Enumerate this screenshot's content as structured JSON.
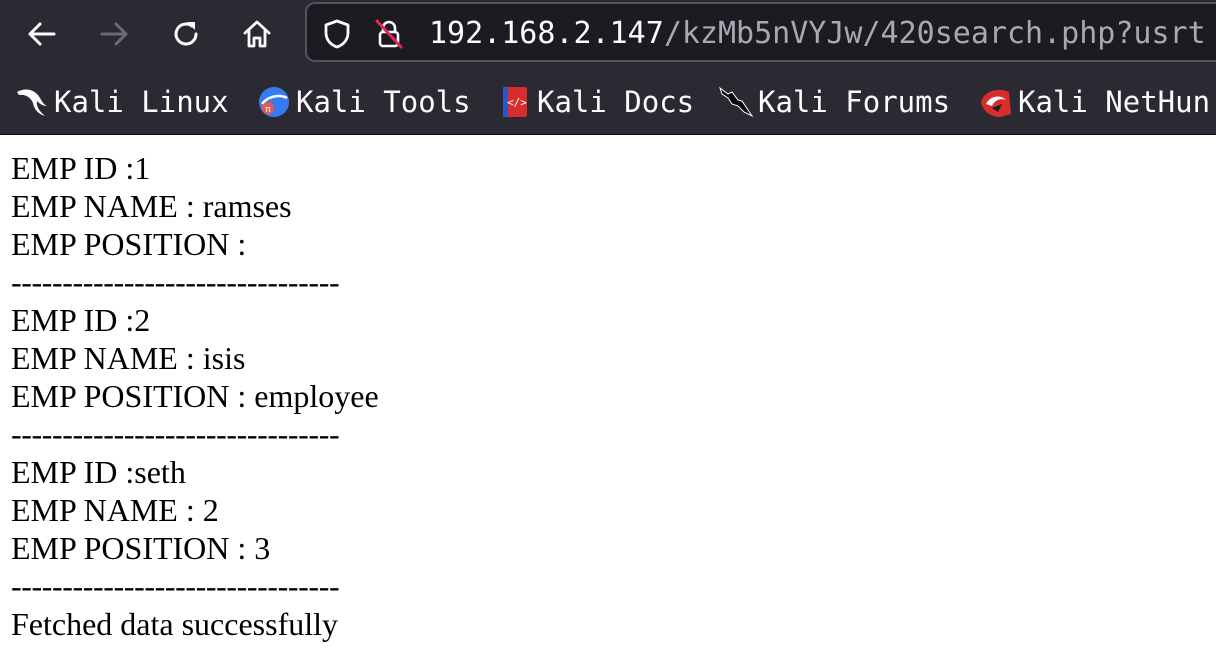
{
  "toolbar": {
    "back_icon": "arrow-left-icon",
    "forward_icon": "arrow-right-icon",
    "reload_icon": "reload-icon",
    "home_icon": "home-icon",
    "url_host": "192.168.2.147",
    "url_path": "/kzMb5nVYJw/420search.php?usrt",
    "shield_icon": "shield-icon",
    "insecure_lock_icon": "insecure-lock-icon"
  },
  "bookmarks": [
    {
      "label": "Kali Linux",
      "icon": "kali-dragon-icon"
    },
    {
      "label": "Kali Tools",
      "icon": "kali-tools-icon"
    },
    {
      "label": "Kali Docs",
      "icon": "kali-docs-icon"
    },
    {
      "label": "Kali Forums",
      "icon": "kali-forums-icon"
    },
    {
      "label": "Kali NetHun",
      "icon": "kali-nethunter-icon"
    }
  ],
  "records": [
    {
      "id_line": "EMP ID :1",
      "name_line": "EMP NAME : ramses",
      "position_line": "EMP POSITION :",
      "separator": "--------------------------------"
    },
    {
      "id_line": "EMP ID :2",
      "name_line": "EMP NAME : isis",
      "position_line": "EMP POSITION : employee",
      "separator": "--------------------------------"
    },
    {
      "id_line": "EMP ID :seth",
      "name_line": "EMP NAME : 2",
      "position_line": "EMP POSITION : 3",
      "separator": "--------------------------------"
    }
  ],
  "status_message": "Fetched data successfully",
  "colors": {
    "chrome_bg": "#2b2a33",
    "urlbar_bg": "#1c1b22",
    "url_host": "#fbfbfe",
    "url_path": "#a8a8b3",
    "insecure_red": "#e22850"
  }
}
